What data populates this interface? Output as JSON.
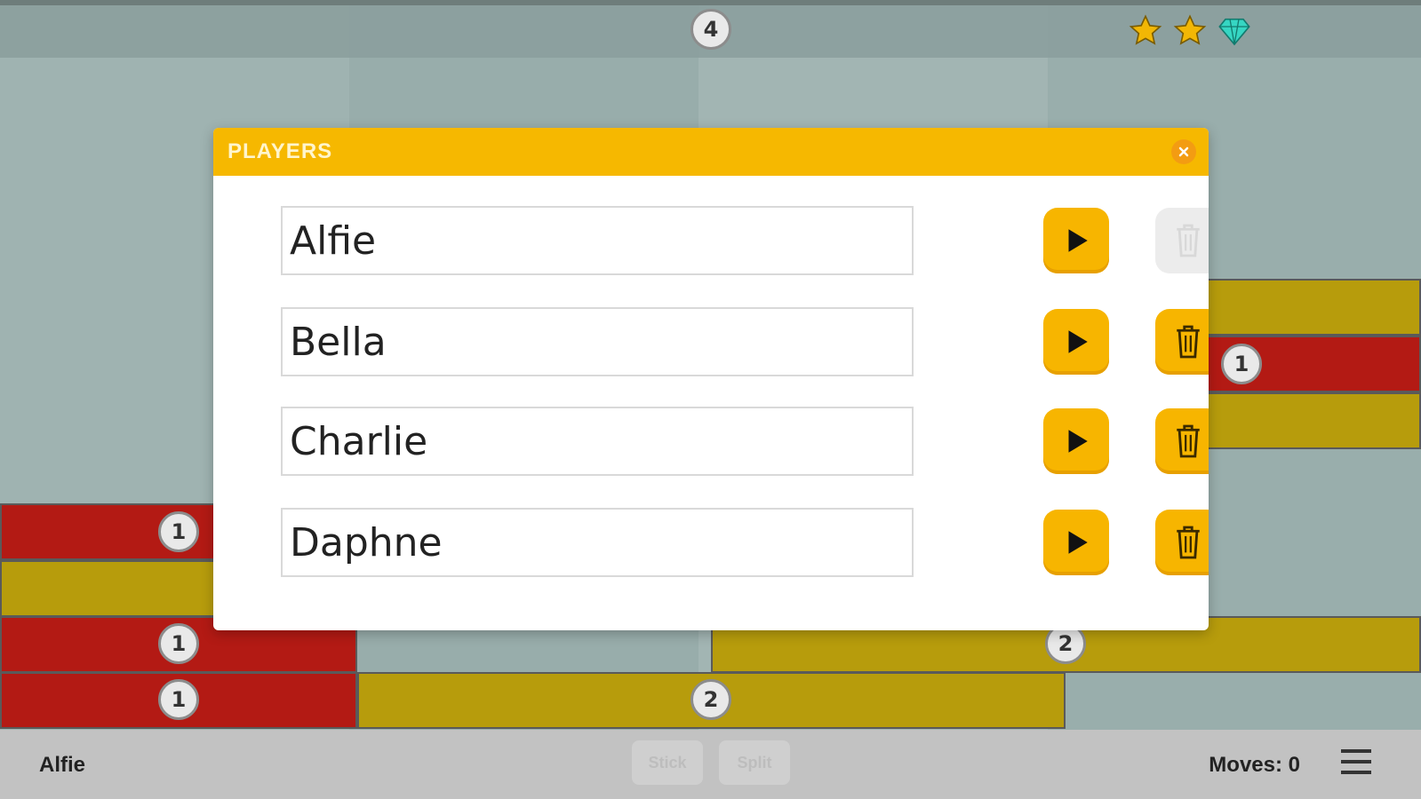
{
  "header": {
    "level_badge": "4",
    "stars": [
      "star-icon",
      "star-icon"
    ],
    "gem": "diamond-icon"
  },
  "board": {
    "block_badges": [
      "1",
      "1",
      "1",
      "1",
      "2",
      "2"
    ]
  },
  "modal": {
    "title": "PLAYERS",
    "players": [
      {
        "name": "Alfie",
        "delete_enabled": false
      },
      {
        "name": "Bella",
        "delete_enabled": true
      },
      {
        "name": "Charlie",
        "delete_enabled": true
      },
      {
        "name": "Daphne",
        "delete_enabled": true
      }
    ]
  },
  "bottom": {
    "current_player": "Alfie",
    "btn1": "Stick",
    "btn2": "Split",
    "moves": "Moves: 0"
  },
  "colors": {
    "accent": "#f7b500",
    "red_block": "#b31a14",
    "yellow_block": "#b79c0c"
  }
}
